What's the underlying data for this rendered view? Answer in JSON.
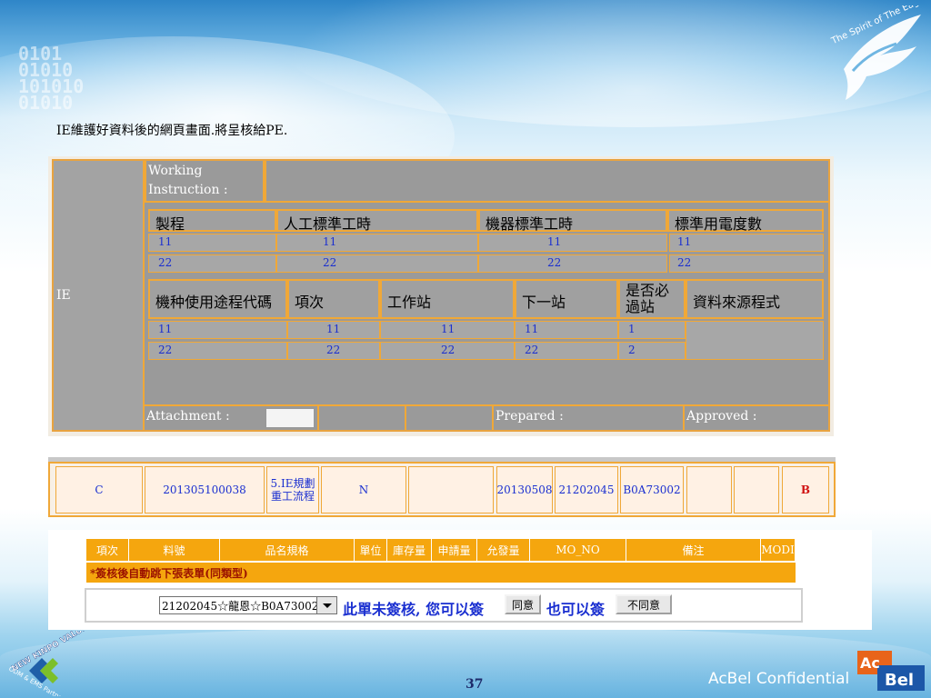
{
  "caption": "IE維護好資料後的網頁畫面.將呈核給PE.",
  "branding": {
    "eagle_text": "The Spirit of The Eagle",
    "kinpo_text": "NEW KINPO VALUE",
    "kinpo_sub": "ODM & EMS Partner",
    "acbel_logo": "AcBel",
    "confidential": "AcBel Confidential",
    "page_number": "37"
  },
  "form": {
    "ie_label": "IE",
    "working_instruction": "Working Instruction :",
    "section1": {
      "headers": [
        "製程",
        "人工標準工時",
        "機器標準工時",
        "標準用電度數"
      ],
      "rows": [
        [
          "11",
          "11",
          "11",
          "11"
        ],
        [
          "22",
          "22",
          "22",
          "22"
        ]
      ]
    },
    "section2": {
      "headers": [
        "機种使用途程代碼",
        "項次",
        "工作站",
        "下一站",
        "是否必過站",
        "資料來源程式"
      ],
      "rows": [
        [
          "11",
          "11",
          "11",
          "11",
          "1"
        ],
        [
          "22",
          "22",
          "22",
          "22",
          "2"
        ]
      ]
    },
    "attachment_label": "Attachment :",
    "prepared_label": "Prepared :",
    "approved_label": "Approved :"
  },
  "mid_row": {
    "cells": [
      "C",
      "201305100038",
      "5.IE規劃重工流程",
      "N",
      "",
      "20130508",
      "21202045",
      "B0A73002",
      "",
      "",
      "B"
    ]
  },
  "order_table": {
    "headers": [
      "項次",
      "料號",
      "品名規格",
      "單位",
      "庫存量",
      "申請量",
      "允發量",
      "MO_NO",
      "備注",
      "MODI"
    ],
    "note": "*簽核後自動跳下張表單(同類型)"
  },
  "sign_bar": {
    "select_value": "21202045☆龍恩☆B0A73002",
    "text_unsigned": "此單未簽核, 您可以簽",
    "agree_button": "同意",
    "text_also": "也可以簽",
    "disagree_button": "不同意"
  },
  "colors": {
    "accent_orange": "#f0a838",
    "header_orange": "#f5a60e",
    "value_blue": "#1a2fd0",
    "form_gray": "#a3a3a3"
  }
}
